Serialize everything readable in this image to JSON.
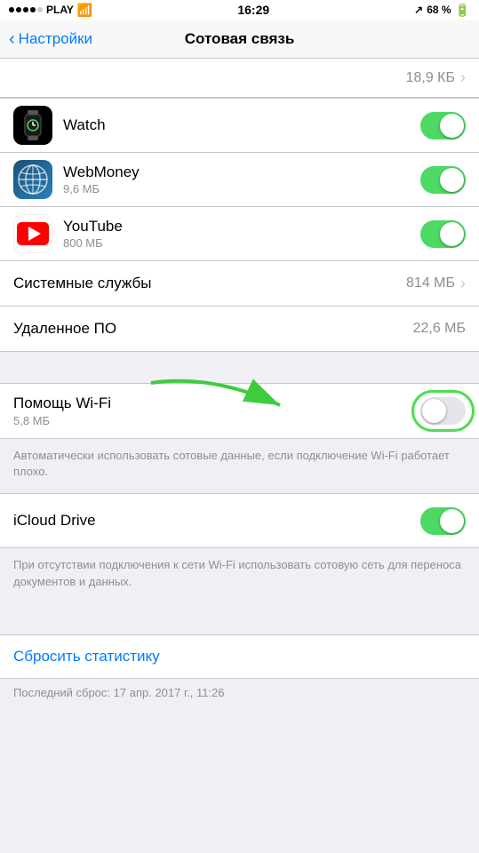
{
  "status_bar": {
    "carrier": "PLAY",
    "time": "16:29",
    "battery": "68 %"
  },
  "nav": {
    "back_label": "Настройки",
    "title": "Сотовая связь"
  },
  "top_partial": {
    "value": "18,9 КБ"
  },
  "apps": [
    {
      "name": "Watch",
      "subtitle": "",
      "toggle": "on",
      "icon_type": "watch"
    },
    {
      "name": "WebMoney",
      "subtitle": "9,6 МБ",
      "toggle": "on",
      "icon_type": "webmoney"
    },
    {
      "name": "YouTube",
      "subtitle": "800 МБ",
      "toggle": "on",
      "icon_type": "youtube"
    }
  ],
  "system_services": {
    "label": "Системные службы",
    "value": "814 МБ"
  },
  "remote_control": {
    "label": "Удаленное ПО",
    "value": "22,6 МБ"
  },
  "wifi_assist": {
    "title": "Помощь Wi-Fi",
    "subtitle": "5,8 МБ",
    "toggle": "off",
    "description": "Автоматически использовать сотовые данные, если подключение Wi-Fi работает плохо."
  },
  "icloud_drive": {
    "title": "iCloud Drive",
    "toggle": "on",
    "description": "При отсутствии подключения к сети Wi-Fi использовать сотовую сеть для переноса документов и данных."
  },
  "reset": {
    "label": "Сбросить статистику",
    "last_reset_label": "Последний сброс:",
    "last_reset_date": "17 апр. 2017 г., 11:26"
  }
}
